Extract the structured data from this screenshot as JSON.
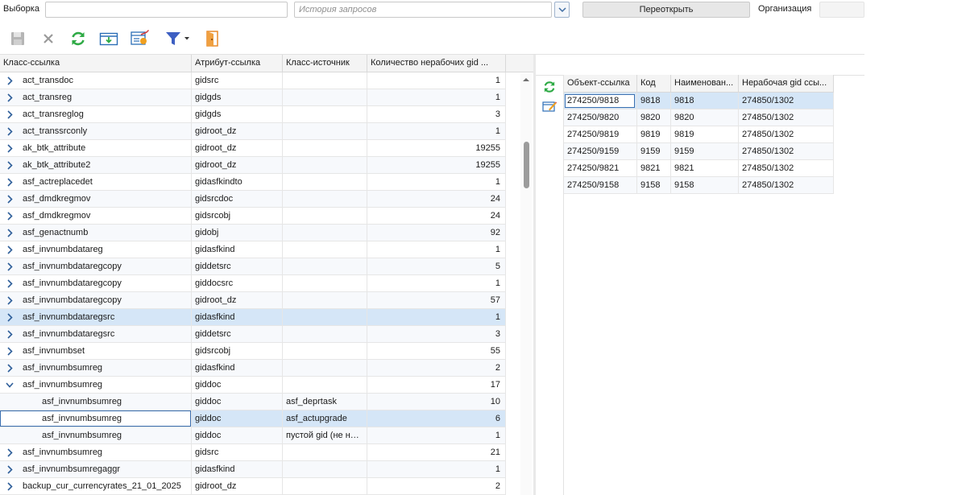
{
  "topbar": {
    "selection_label": "Выборка",
    "selection_value": "",
    "history_placeholder": "История запросов",
    "reopen_label": "Переоткрыть",
    "org_label": "Организация",
    "org_value": ""
  },
  "toolbar": {
    "icons": [
      "save-icon",
      "delete-icon",
      "refresh-icon",
      "export-icon",
      "report-settings-icon",
      "filter-icon",
      "exit-icon"
    ]
  },
  "left_grid": {
    "columns": [
      "Класс-ссылка",
      "Атрибут-ссылка",
      "Класс-источник",
      "Количество нерабочих gid ..."
    ],
    "rows": [
      {
        "cls": "act_transdoc",
        "attr": "gidsrc",
        "src": "",
        "count": "1",
        "indent": 0,
        "expand": "collapsed"
      },
      {
        "cls": "act_transreg",
        "attr": "gidgds",
        "src": "",
        "count": "1",
        "indent": 0,
        "expand": "collapsed"
      },
      {
        "cls": "act_transreglog",
        "attr": "gidgds",
        "src": "",
        "count": "3",
        "indent": 0,
        "expand": "collapsed"
      },
      {
        "cls": "act_transsrconly",
        "attr": "gidroot_dz",
        "src": "",
        "count": "1",
        "indent": 0,
        "expand": "collapsed"
      },
      {
        "cls": "ak_btk_attribute",
        "attr": "gidroot_dz",
        "src": "",
        "count": "19255",
        "indent": 0,
        "expand": "collapsed"
      },
      {
        "cls": "ak_btk_attribute2",
        "attr": "gidroot_dz",
        "src": "",
        "count": "19255",
        "indent": 0,
        "expand": "collapsed"
      },
      {
        "cls": "asf_actreplacedet",
        "attr": "gidasfkindto",
        "src": "",
        "count": "1",
        "indent": 0,
        "expand": "collapsed"
      },
      {
        "cls": "asf_dmdkregmov",
        "attr": "gidsrcdoc",
        "src": "",
        "count": "24",
        "indent": 0,
        "expand": "collapsed"
      },
      {
        "cls": "asf_dmdkregmov",
        "attr": "gidsrcobj",
        "src": "",
        "count": "24",
        "indent": 0,
        "expand": "collapsed"
      },
      {
        "cls": "asf_genactnumb",
        "attr": "gidobj",
        "src": "",
        "count": "92",
        "indent": 0,
        "expand": "collapsed"
      },
      {
        "cls": "asf_invnumbdatareg",
        "attr": "gidasfkind",
        "src": "",
        "count": "1",
        "indent": 0,
        "expand": "collapsed"
      },
      {
        "cls": "asf_invnumbdataregcopy",
        "attr": "giddetsrc",
        "src": "",
        "count": "5",
        "indent": 0,
        "expand": "collapsed"
      },
      {
        "cls": "asf_invnumbdataregcopy",
        "attr": "giddocsrc",
        "src": "",
        "count": "1",
        "indent": 0,
        "expand": "collapsed"
      },
      {
        "cls": "asf_invnumbdataregcopy",
        "attr": "gidroot_dz",
        "src": "",
        "count": "57",
        "indent": 0,
        "expand": "collapsed"
      },
      {
        "cls": "asf_invnumbdataregsrc",
        "attr": "gidasfkind",
        "src": "",
        "count": "1",
        "indent": 0,
        "expand": "collapsed",
        "selected": true
      },
      {
        "cls": "asf_invnumbdataregsrc",
        "attr": "giddetsrc",
        "src": "",
        "count": "3",
        "indent": 0,
        "expand": "collapsed"
      },
      {
        "cls": "asf_invnumbset",
        "attr": "gidsrcobj",
        "src": "",
        "count": "55",
        "indent": 0,
        "expand": "collapsed"
      },
      {
        "cls": "asf_invnumbsumreg",
        "attr": "gidasfkind",
        "src": "",
        "count": "2",
        "indent": 0,
        "expand": "collapsed"
      },
      {
        "cls": "asf_invnumbsumreg",
        "attr": "giddoc",
        "src": "",
        "count": "17",
        "indent": 0,
        "expand": "expanded"
      },
      {
        "cls": "asf_invnumbsumreg",
        "attr": "giddoc",
        "src": "asf_deprtask",
        "count": "10",
        "indent": 1,
        "expand": "none"
      },
      {
        "cls": "asf_invnumbsumreg",
        "attr": "giddoc",
        "src": "asf_actupgrade",
        "count": "6",
        "indent": 1,
        "expand": "none",
        "selected": true,
        "focused": true
      },
      {
        "cls": "asf_invnumbsumreg",
        "attr": "giddoc",
        "src": "пустой gid (не найден)",
        "count": "1",
        "indent": 1,
        "expand": "none"
      },
      {
        "cls": "asf_invnumbsumreg",
        "attr": "gidsrc",
        "src": "",
        "count": "21",
        "indent": 0,
        "expand": "collapsed"
      },
      {
        "cls": "asf_invnumbsumregaggr",
        "attr": "gidasfkind",
        "src": "",
        "count": "1",
        "indent": 0,
        "expand": "collapsed"
      },
      {
        "cls": "backup_cur_currencyrates_21_01_2025",
        "attr": "gidroot_dz",
        "src": "",
        "count": "2",
        "indent": 0,
        "expand": "collapsed"
      }
    ]
  },
  "right_panel": {
    "icons": [
      "refresh-icon",
      "edit-icon"
    ],
    "columns": [
      "Объект-ссылка",
      "Код",
      "Наименован...",
      "Нерабочая gid ссы..."
    ],
    "rows": [
      {
        "obj": "274250/9818",
        "code": "9818",
        "name": "9818",
        "gid": "274850/1302",
        "selected": true
      },
      {
        "obj": "274250/9820",
        "code": "9820",
        "name": "9820",
        "gid": "274850/1302"
      },
      {
        "obj": "274250/9819",
        "code": "9819",
        "name": "9819",
        "gid": "274850/1302"
      },
      {
        "obj": "274250/9159",
        "code": "9159",
        "name": "9159",
        "gid": "274850/1302"
      },
      {
        "obj": "274250/9821",
        "code": "9821",
        "name": "9821",
        "gid": "274850/1302"
      },
      {
        "obj": "274250/9158",
        "code": "9158",
        "name": "9158",
        "gid": "274850/1302"
      }
    ]
  }
}
